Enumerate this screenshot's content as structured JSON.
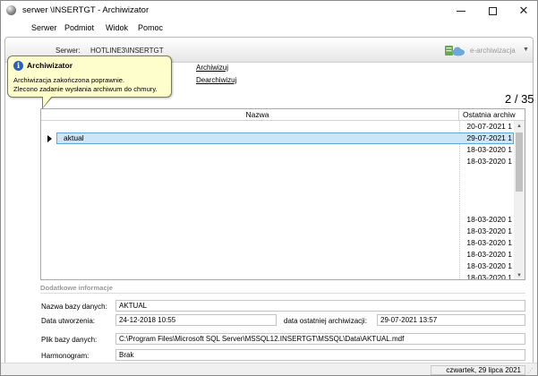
{
  "window": {
    "title": "serwer \\INSERTGT - Archiwizator"
  },
  "menu": [
    "Serwer",
    "Podmiot",
    "Widok",
    "Pomoc"
  ],
  "server_bar": {
    "label": "Serwer:",
    "name": "HOTLINE3\\INSERTGT",
    "earchiwizacja": "e-archiwizacja"
  },
  "tooltip": {
    "title": "Archiwizator",
    "line1": "Archiwizacja zakończona poprawnie.",
    "line2": "Zlecono zadanie wysłania archiwum do chmury."
  },
  "links": {
    "archiwizuj": "Archiwizuj",
    "dearchiwizuj": "Dearchiwizuj"
  },
  "counter": "2 / 35",
  "grid": {
    "columns": [
      "Nazwa",
      "Ostatnia archiw"
    ],
    "rows": [
      {
        "name": "",
        "date": "20-07-2021 1"
      },
      {
        "name": "aktual",
        "date": "29-07-2021 1"
      },
      {
        "name": "",
        "date": "18-03-2020 1"
      },
      {
        "name": "",
        "date": "18-03-2020 1"
      },
      {
        "name": "",
        "date": ""
      },
      {
        "name": "",
        "date": ""
      },
      {
        "name": "",
        "date": ""
      },
      {
        "name": "",
        "date": ""
      },
      {
        "name": "",
        "date": "18-03-2020 1"
      },
      {
        "name": "",
        "date": "18-03-2020 1"
      },
      {
        "name": "",
        "date": "18-03-2020 1"
      },
      {
        "name": "",
        "date": "18-03-2020 1"
      },
      {
        "name": "",
        "date": "18-03-2020 1"
      },
      {
        "name": "",
        "date": "18-03-2020 1"
      }
    ],
    "selected_index": 1
  },
  "details": {
    "title": "Dodatkowe informacje",
    "db_name_label": "Nazwa bazy danych:",
    "db_name_value": "AKTUAL",
    "created_label": "Data utworzenia:",
    "created_value": "24-12-2018 10:55",
    "last_archive_label": "data ostatniej archiwizacji:",
    "last_archive_value": "29-07-2021 13:57",
    "file_label": "Plik bazy danych:",
    "file_value": "C:\\Program Files\\Microsoft SQL Server\\MSSQL12.INSERTGT\\MSSQL\\Data\\AKTUAL.mdf",
    "schedule_label": "Harmonogram:",
    "schedule_value": "Brak"
  },
  "status": {
    "date": "czwartek, 29 lipca 2021"
  },
  "colors": {
    "selection_fill": "#cde6f7",
    "selection_border": "#5aa8dc",
    "tooltip_bg": "#fefecd",
    "info_icon": "#2a5fc0"
  }
}
